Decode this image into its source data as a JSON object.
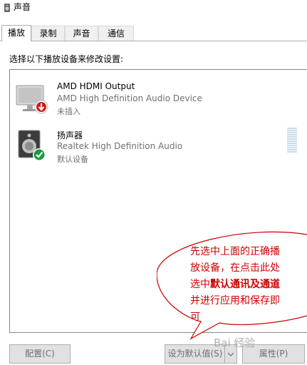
{
  "window": {
    "title": "声音"
  },
  "tabs": [
    {
      "label": "播放",
      "active": true
    },
    {
      "label": "录制",
      "active": false
    },
    {
      "label": "声音",
      "active": false
    },
    {
      "label": "通信",
      "active": false
    }
  ],
  "instruction": "选择以下播放设备来修改设置:",
  "devices": [
    {
      "name": "AMD HDMI Output",
      "description": "AMD High Definition Audio Device",
      "status": "未插入",
      "icon": "monitor-icon",
      "badge": "unplugged-arrow-icon"
    },
    {
      "name": "扬声器",
      "description": "Realtek High Definition Audio",
      "status": "默认设备",
      "icon": "speaker-icon",
      "badge": "default-check-icon"
    }
  ],
  "annotation": {
    "line1": "先选中上面的正确播",
    "line2": "放设备，在点击此处",
    "line3_a": "选中",
    "line3_b": "默认通讯及通道",
    "line4": "并进行应用和保存即",
    "line5": "可"
  },
  "buttons": {
    "configure": "配置(C)",
    "set_default": "设为默认值(S)",
    "properties": "属性(P)"
  },
  "watermark": "Bai 经验",
  "colors": {
    "annotation_red": "#cc0000",
    "check_green": "#1a9b3a",
    "unplug_red": "#d11a1a"
  }
}
